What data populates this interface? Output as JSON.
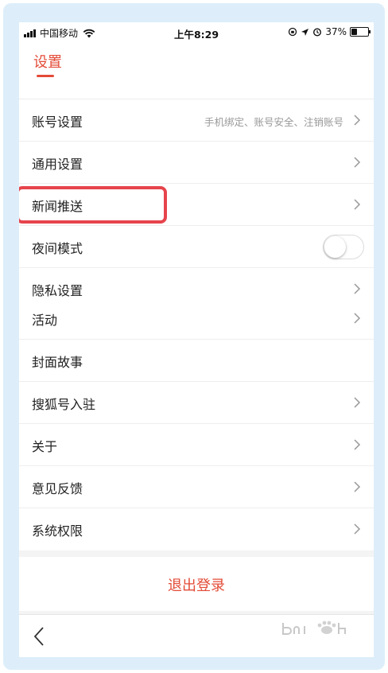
{
  "status_bar": {
    "carrier": "中国移动",
    "time": "上午8:29",
    "battery_percent": "37%",
    "battery_level": 0.37
  },
  "header": {
    "title": "设置"
  },
  "groups": [
    {
      "items": [
        {
          "label": "账号设置",
          "detail": "手机绑定、账号安全、注销账号",
          "accessory": "chevron"
        },
        {
          "label": "通用设置",
          "accessory": "chevron"
        },
        {
          "label": "新闻推送",
          "accessory": "chevron",
          "highlighted": true
        },
        {
          "label": "夜间模式",
          "accessory": "toggle",
          "toggle_on": false
        },
        {
          "label": "隐私设置",
          "accessory": "chevron"
        }
      ]
    },
    {
      "items": [
        {
          "label": "活动",
          "accessory": "chevron"
        },
        {
          "label": "封面故事",
          "accessory": "none"
        },
        {
          "label": "搜狐号入驻",
          "accessory": "chevron"
        },
        {
          "label": "关于",
          "accessory": "chevron"
        },
        {
          "label": "意见反馈",
          "accessory": "chevron"
        },
        {
          "label": "系统权限",
          "accessory": "chevron"
        }
      ]
    }
  ],
  "logout_label": "退出登录",
  "colors": {
    "accent": "#e34b37",
    "highlight_border": "#e6444c",
    "frame": "#ddeefa"
  },
  "icons": {
    "back": "chevron-left-icon",
    "row_arrow": "chevron-right-icon"
  }
}
